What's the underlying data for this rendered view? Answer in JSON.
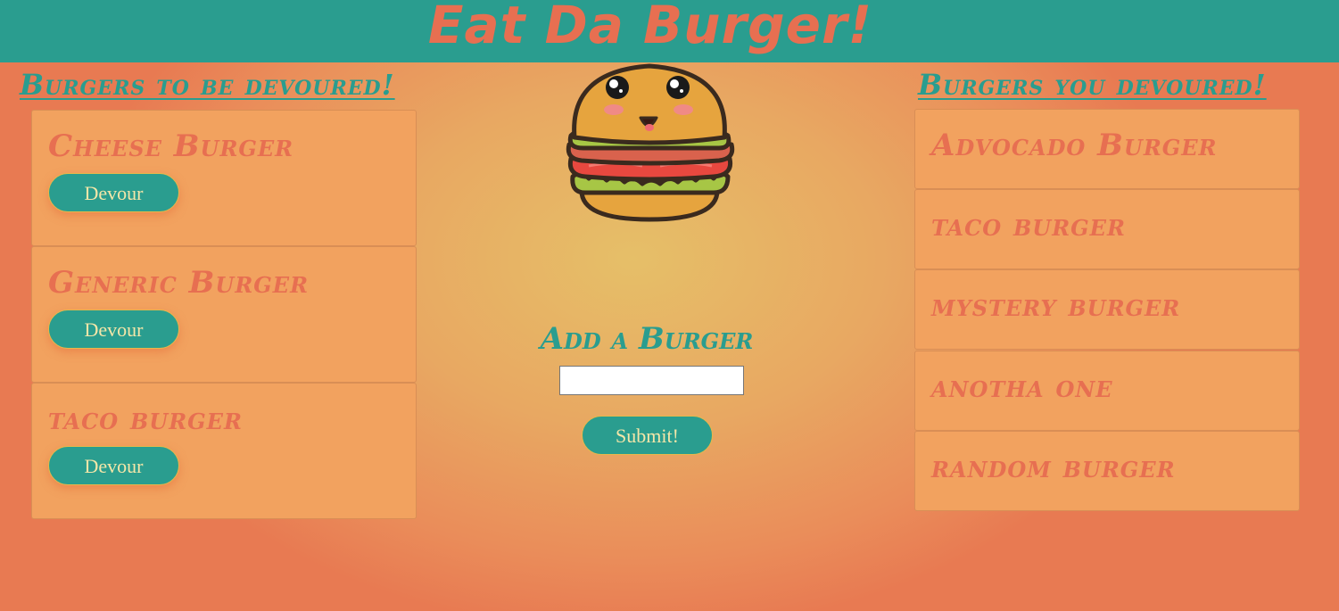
{
  "header": {
    "title": "Eat Da Burger!"
  },
  "left_column": {
    "heading": "Burgers to be devoured!",
    "burgers": [
      {
        "name": "Cheese Burger",
        "button_label": "Devour"
      },
      {
        "name": "Generic Burger",
        "button_label": "Devour"
      },
      {
        "name": "taco burger",
        "button_label": "Devour"
      }
    ]
  },
  "center": {
    "mascot_icon": "cute-burger-icon",
    "add_title": "Add a Burger",
    "input_value": "",
    "submit_label": "Submit!"
  },
  "right_column": {
    "heading": "Burgers you devoured!",
    "burgers": [
      {
        "name": "Advocado Burger"
      },
      {
        "name": "taco burger"
      },
      {
        "name": "mystery burger"
      },
      {
        "name": "anotha one"
      },
      {
        "name": "random burger"
      }
    ]
  },
  "colors": {
    "teal": "#2a9d8f",
    "coral": "#e76f51",
    "card": "#f2a25f",
    "button_text": "#f4e6a8"
  }
}
